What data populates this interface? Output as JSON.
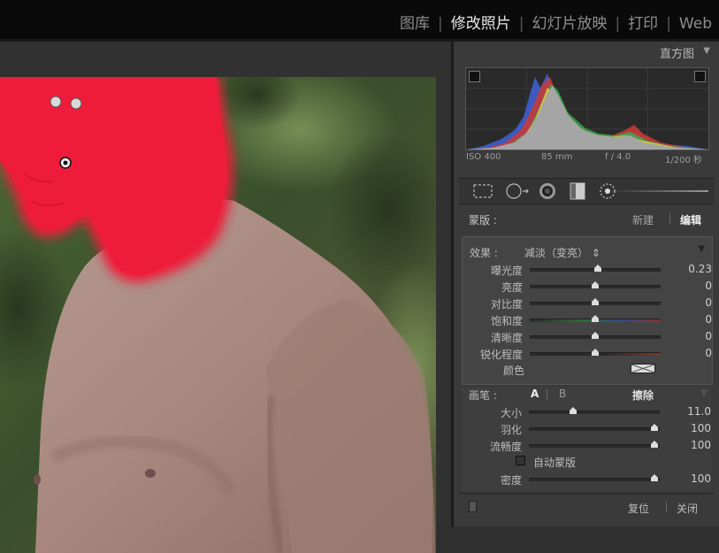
{
  "modules": [
    {
      "label": "图库",
      "active": false
    },
    {
      "label": "修改照片",
      "active": true
    },
    {
      "label": "幻灯片放映",
      "active": false
    },
    {
      "label": "打印",
      "active": false
    },
    {
      "label": "Web",
      "active": false
    }
  ],
  "histogram": {
    "title": "直方图",
    "iso": "ISO 400",
    "focal": "85 mm",
    "aperture": "f / 4.0",
    "shutter": "1/200 秒"
  },
  "mask": {
    "label": "蒙版 :",
    "new": "新建",
    "edit": "编辑"
  },
  "effect": {
    "label": "效果 :",
    "value": "减淡（变亮）",
    "value_symbol": "⇕",
    "sliders": [
      {
        "label": "曝光度",
        "value": "0.23",
        "fraction": 0.52
      },
      {
        "label": "亮度",
        "value": "0",
        "fraction": 0.5
      },
      {
        "label": "对比度",
        "value": "0",
        "fraction": 0.5
      },
      {
        "label": "饱和度",
        "value": "0",
        "fraction": 0.5
      },
      {
        "label": "清晰度",
        "value": "0",
        "fraction": 0.5
      },
      {
        "label": "锐化程度",
        "value": "0",
        "fraction": 0.5
      }
    ],
    "color_label": "颜色"
  },
  "brush": {
    "label": "画笔 :",
    "a": "A",
    "b": "B",
    "erase": "擦除",
    "sliders": [
      {
        "label": "大小",
        "value": "11.0",
        "fraction": 0.34
      },
      {
        "label": "羽化",
        "value": "100",
        "fraction": 0.96
      },
      {
        "label": "流畅度",
        "value": "100",
        "fraction": 0.96
      }
    ],
    "auto_mask": "自动蒙版",
    "density": {
      "label": "密度",
      "value": "100",
      "fraction": 0.96
    }
  },
  "footer": {
    "reset": "复位",
    "close": "关闭"
  },
  "colors": {
    "mask_overlay": "#ee1c3a",
    "panel_bg": "#3a3a3a",
    "topbar_bg": "#0a0a0a"
  }
}
